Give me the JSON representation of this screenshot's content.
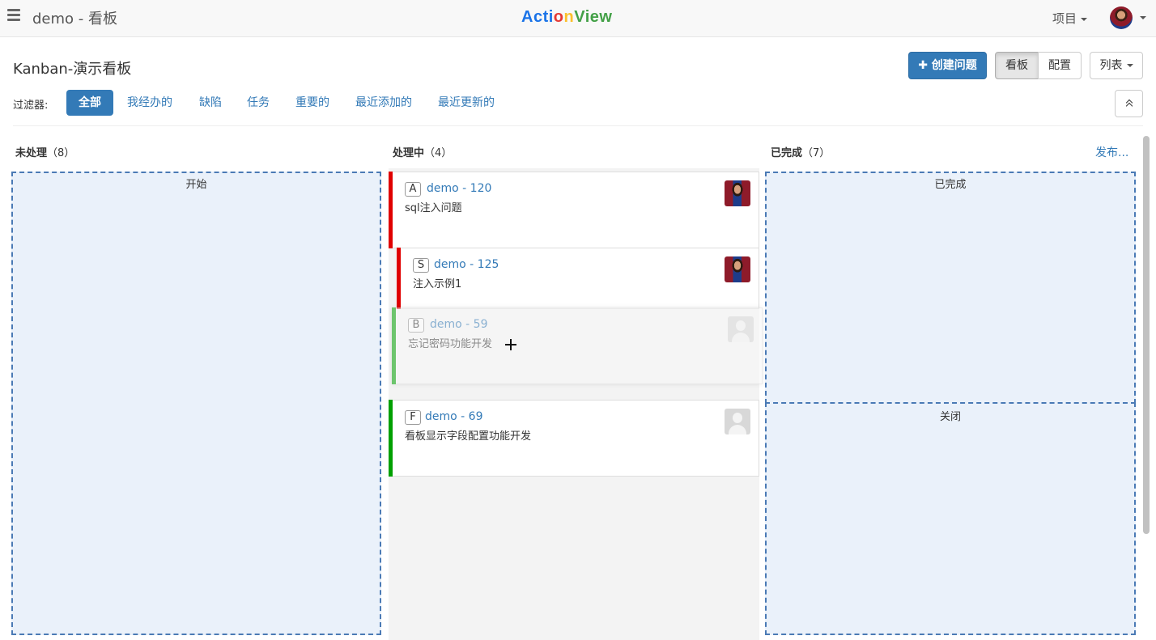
{
  "navbar": {
    "project_title": "demo - 看板",
    "logo": {
      "part1": "Acti",
      "part2": "o",
      "part3": "n",
      "part4": "View"
    },
    "projects_menu": "项目"
  },
  "header": {
    "board_title": "Kanban-演示看板",
    "create_button": "创建问题",
    "view_kanban": "看板",
    "view_config": "配置",
    "list_menu": "列表"
  },
  "filters": {
    "label": "过滤器:",
    "items": [
      "全部",
      "我经办的",
      "缺陷",
      "任务",
      "重要的",
      "最近添加的",
      "最近更新的"
    ],
    "active": "全部"
  },
  "columns": [
    {
      "name": "未处理",
      "count": "（8）",
      "zones": [
        "开始"
      ]
    },
    {
      "name": "处理中",
      "count": "（4）"
    },
    {
      "name": "已完成",
      "count": "（7）",
      "zones": [
        "已完成",
        "关闭"
      ],
      "action": "发布..."
    }
  ],
  "cards": [
    {
      "type": "A",
      "key": "demo - 120",
      "summary": "sql注入问题",
      "priority_color": "#e00000",
      "avatar": "user-photo"
    },
    {
      "type": "S",
      "key": "demo - 125",
      "summary": "注入示例1",
      "priority_color": "#e00000",
      "avatar": "user-photo"
    },
    {
      "type": "B",
      "key": "demo - 59",
      "summary": "忘记密码功能开发",
      "priority_color": "#00a000",
      "avatar": "blank-avatar",
      "state": "dragging"
    },
    {
      "type": "F",
      "key": "demo - 69",
      "summary": "看板显示字段配置功能开发",
      "priority_color": "#00a000",
      "avatar": "blank-avatar"
    }
  ],
  "colors": {
    "primary": "#337ab7",
    "high_priority": "#e00000",
    "normal_priority": "#00a000",
    "dropzone_bg": "#eaf1fa"
  }
}
